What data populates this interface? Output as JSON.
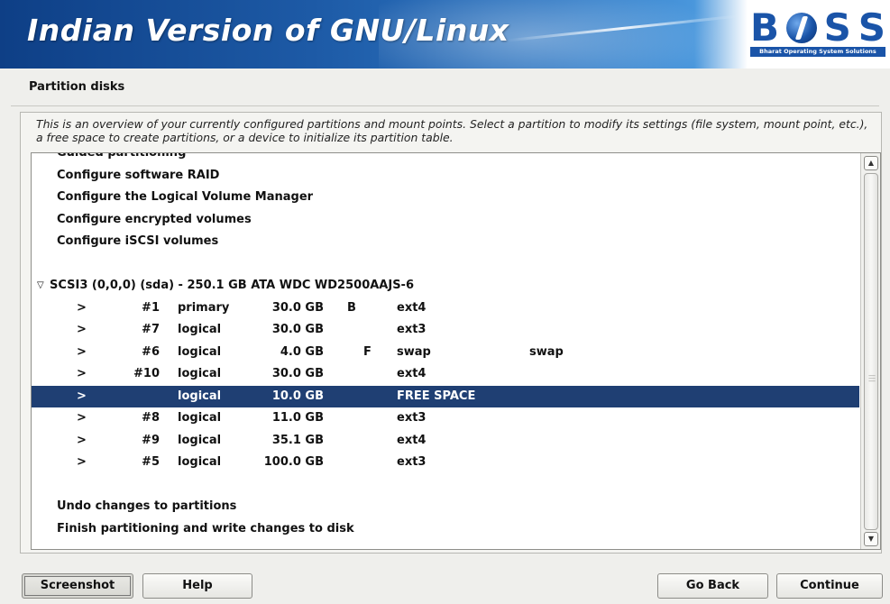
{
  "banner": {
    "title": "Indian Version of GNU/Linux",
    "logo_letters": [
      "B",
      "",
      "S",
      "S"
    ],
    "logo_tagline": "Bharat Operating System Solutions"
  },
  "page": {
    "title": "Partition disks",
    "description": "This is an overview of your currently configured partitions and mount points. Select a partition to modify its settings (file system, mount point, etc.), a free space to create partitions, or a device to initialize its partition table."
  },
  "menu_top": [
    "Guided partitioning",
    "Configure software RAID",
    "Configure the Logical Volume Manager",
    "Configure encrypted volumes",
    "Configure iSCSI volumes"
  ],
  "disk": {
    "expander": "▽",
    "label": "SCSI3 (0,0,0) (sda) - 250.1 GB ATA WDC WD2500AAJS-6"
  },
  "partitions": [
    {
      "arrow": ">",
      "num": "#1",
      "type": "primary",
      "size": "30.0 GB",
      "flag1": "B",
      "flag2": "",
      "fs": "ext4",
      "mount": "",
      "selected": false
    },
    {
      "arrow": ">",
      "num": "#7",
      "type": "logical",
      "size": "30.0 GB",
      "flag1": "",
      "flag2": "",
      "fs": "ext3",
      "mount": "",
      "selected": false
    },
    {
      "arrow": ">",
      "num": "#6",
      "type": "logical",
      "size": "4.0 GB",
      "flag1": "",
      "flag2": "F",
      "fs": "swap",
      "mount": "swap",
      "selected": false
    },
    {
      "arrow": ">",
      "num": "#10",
      "type": "logical",
      "size": "30.0 GB",
      "flag1": "",
      "flag2": "",
      "fs": "ext4",
      "mount": "",
      "selected": false
    },
    {
      "arrow": ">",
      "num": "",
      "type": "logical",
      "size": "10.0 GB",
      "flag1": "",
      "flag2": "",
      "fs": "FREE SPACE",
      "mount": "",
      "selected": true
    },
    {
      "arrow": ">",
      "num": "#8",
      "type": "logical",
      "size": "11.0 GB",
      "flag1": "",
      "flag2": "",
      "fs": "ext3",
      "mount": "",
      "selected": false
    },
    {
      "arrow": ">",
      "num": "#9",
      "type": "logical",
      "size": "35.1 GB",
      "flag1": "",
      "flag2": "",
      "fs": "ext4",
      "mount": "",
      "selected": false
    },
    {
      "arrow": ">",
      "num": "#5",
      "type": "logical",
      "size": "100.0 GB",
      "flag1": "",
      "flag2": "",
      "fs": "ext3",
      "mount": "",
      "selected": false
    }
  ],
  "menu_bottom": [
    "Undo changes to partitions",
    "Finish partitioning and write changes to disk"
  ],
  "buttons": {
    "screenshot": "Screenshot",
    "help": "Help",
    "go_back": "Go Back",
    "continue": "Continue"
  },
  "colors": {
    "selection": "#1f3f73",
    "banner_blue": "#1d5aa6",
    "logo_blue": "#1a54a8"
  },
  "icons": {
    "scroll_up": "chevron-up-icon",
    "scroll_down": "chevron-down-icon",
    "disk_expander": "triangle-down-icon"
  }
}
